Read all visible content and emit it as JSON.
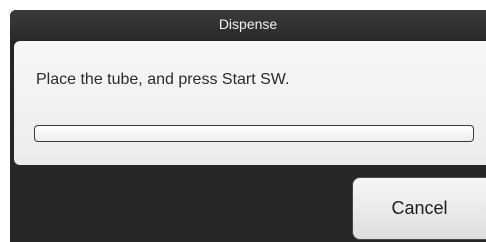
{
  "dialog": {
    "title": "Dispense",
    "message": "Place the tube, and press Start SW.",
    "progress": 0,
    "cancel_label": "Cancel"
  }
}
